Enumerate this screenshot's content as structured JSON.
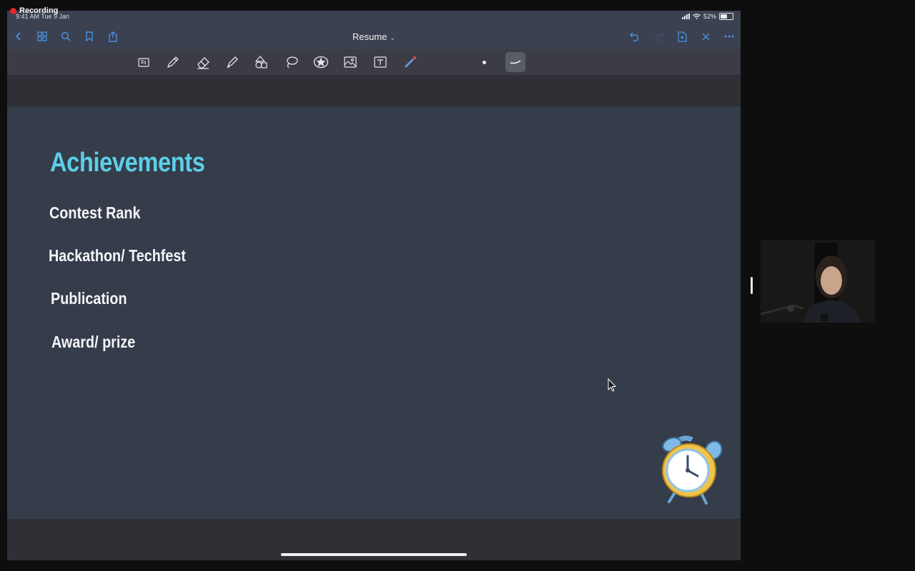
{
  "recording": {
    "label": "Recording"
  },
  "status_bar": {
    "time": "9:41 AM  Tue 9 Jan",
    "battery": "52%"
  },
  "nav": {
    "title": "Resume"
  },
  "icons": {
    "back": "chevron-left-icon",
    "grid": "grid-icon",
    "search": "search-icon",
    "bookmark": "bookmark-icon",
    "share": "share-icon",
    "undo": "undo-icon",
    "redo": "redo-icon",
    "add_page": "add-page-icon",
    "close": "close-icon",
    "more": "more-icon"
  },
  "toolbar": {
    "tools": [
      "read-mode",
      "pen",
      "eraser",
      "highlighter",
      "shapes",
      "lasso",
      "sticker",
      "image",
      "text",
      "laser-pointer"
    ],
    "selected_stroke": "curve"
  },
  "page": {
    "heading": "Achievements",
    "items": [
      "Contest Rank",
      "Hackathon/ Techfest",
      "Publication",
      "Award/ prize"
    ],
    "sticker": "alarm-clock"
  },
  "colors": {
    "heading": "#5ccfe6",
    "page_bg": "#353c4a",
    "toolbar_bg": "#3b4150",
    "accent": "#4a90e2"
  }
}
